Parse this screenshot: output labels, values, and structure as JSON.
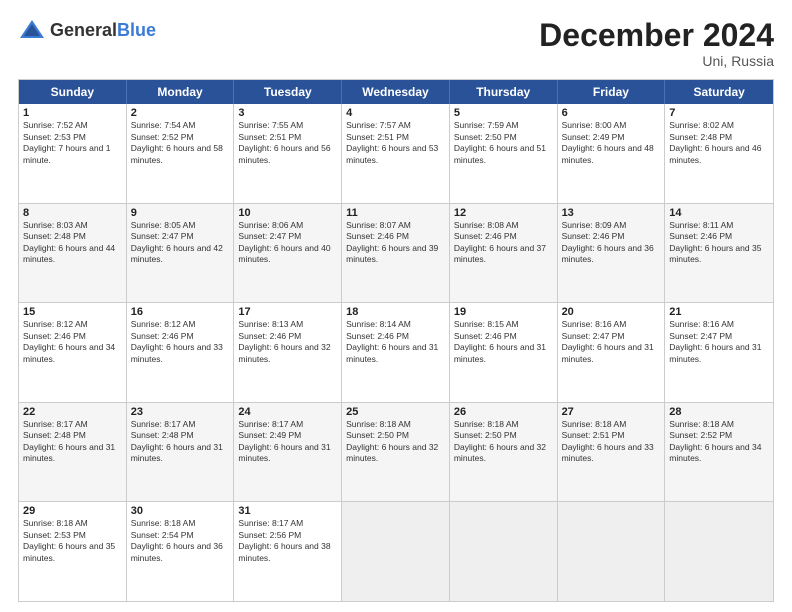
{
  "header": {
    "logo_general": "General",
    "logo_blue": "Blue",
    "title": "December 2024",
    "location": "Uni, Russia"
  },
  "days_of_week": [
    "Sunday",
    "Monday",
    "Tuesday",
    "Wednesday",
    "Thursday",
    "Friday",
    "Saturday"
  ],
  "weeks": [
    [
      {
        "day": "1",
        "sunrise": "Sunrise: 7:52 AM",
        "sunset": "Sunset: 2:53 PM",
        "daylight": "Daylight: 7 hours and 1 minute."
      },
      {
        "day": "2",
        "sunrise": "Sunrise: 7:54 AM",
        "sunset": "Sunset: 2:52 PM",
        "daylight": "Daylight: 6 hours and 58 minutes."
      },
      {
        "day": "3",
        "sunrise": "Sunrise: 7:55 AM",
        "sunset": "Sunset: 2:51 PM",
        "daylight": "Daylight: 6 hours and 56 minutes."
      },
      {
        "day": "4",
        "sunrise": "Sunrise: 7:57 AM",
        "sunset": "Sunset: 2:51 PM",
        "daylight": "Daylight: 6 hours and 53 minutes."
      },
      {
        "day": "5",
        "sunrise": "Sunrise: 7:59 AM",
        "sunset": "Sunset: 2:50 PM",
        "daylight": "Daylight: 6 hours and 51 minutes."
      },
      {
        "day": "6",
        "sunrise": "Sunrise: 8:00 AM",
        "sunset": "Sunset: 2:49 PM",
        "daylight": "Daylight: 6 hours and 48 minutes."
      },
      {
        "day": "7",
        "sunrise": "Sunrise: 8:02 AM",
        "sunset": "Sunset: 2:48 PM",
        "daylight": "Daylight: 6 hours and 46 minutes."
      }
    ],
    [
      {
        "day": "8",
        "sunrise": "Sunrise: 8:03 AM",
        "sunset": "Sunset: 2:48 PM",
        "daylight": "Daylight: 6 hours and 44 minutes."
      },
      {
        "day": "9",
        "sunrise": "Sunrise: 8:05 AM",
        "sunset": "Sunset: 2:47 PM",
        "daylight": "Daylight: 6 hours and 42 minutes."
      },
      {
        "day": "10",
        "sunrise": "Sunrise: 8:06 AM",
        "sunset": "Sunset: 2:47 PM",
        "daylight": "Daylight: 6 hours and 40 minutes."
      },
      {
        "day": "11",
        "sunrise": "Sunrise: 8:07 AM",
        "sunset": "Sunset: 2:46 PM",
        "daylight": "Daylight: 6 hours and 39 minutes."
      },
      {
        "day": "12",
        "sunrise": "Sunrise: 8:08 AM",
        "sunset": "Sunset: 2:46 PM",
        "daylight": "Daylight: 6 hours and 37 minutes."
      },
      {
        "day": "13",
        "sunrise": "Sunrise: 8:09 AM",
        "sunset": "Sunset: 2:46 PM",
        "daylight": "Daylight: 6 hours and 36 minutes."
      },
      {
        "day": "14",
        "sunrise": "Sunrise: 8:11 AM",
        "sunset": "Sunset: 2:46 PM",
        "daylight": "Daylight: 6 hours and 35 minutes."
      }
    ],
    [
      {
        "day": "15",
        "sunrise": "Sunrise: 8:12 AM",
        "sunset": "Sunset: 2:46 PM",
        "daylight": "Daylight: 6 hours and 34 minutes."
      },
      {
        "day": "16",
        "sunrise": "Sunrise: 8:12 AM",
        "sunset": "Sunset: 2:46 PM",
        "daylight": "Daylight: 6 hours and 33 minutes."
      },
      {
        "day": "17",
        "sunrise": "Sunrise: 8:13 AM",
        "sunset": "Sunset: 2:46 PM",
        "daylight": "Daylight: 6 hours and 32 minutes."
      },
      {
        "day": "18",
        "sunrise": "Sunrise: 8:14 AM",
        "sunset": "Sunset: 2:46 PM",
        "daylight": "Daylight: 6 hours and 31 minutes."
      },
      {
        "day": "19",
        "sunrise": "Sunrise: 8:15 AM",
        "sunset": "Sunset: 2:46 PM",
        "daylight": "Daylight: 6 hours and 31 minutes."
      },
      {
        "day": "20",
        "sunrise": "Sunrise: 8:16 AM",
        "sunset": "Sunset: 2:47 PM",
        "daylight": "Daylight: 6 hours and 31 minutes."
      },
      {
        "day": "21",
        "sunrise": "Sunrise: 8:16 AM",
        "sunset": "Sunset: 2:47 PM",
        "daylight": "Daylight: 6 hours and 31 minutes."
      }
    ],
    [
      {
        "day": "22",
        "sunrise": "Sunrise: 8:17 AM",
        "sunset": "Sunset: 2:48 PM",
        "daylight": "Daylight: 6 hours and 31 minutes."
      },
      {
        "day": "23",
        "sunrise": "Sunrise: 8:17 AM",
        "sunset": "Sunset: 2:48 PM",
        "daylight": "Daylight: 6 hours and 31 minutes."
      },
      {
        "day": "24",
        "sunrise": "Sunrise: 8:17 AM",
        "sunset": "Sunset: 2:49 PM",
        "daylight": "Daylight: 6 hours and 31 minutes."
      },
      {
        "day": "25",
        "sunrise": "Sunrise: 8:18 AM",
        "sunset": "Sunset: 2:50 PM",
        "daylight": "Daylight: 6 hours and 32 minutes."
      },
      {
        "day": "26",
        "sunrise": "Sunrise: 8:18 AM",
        "sunset": "Sunset: 2:50 PM",
        "daylight": "Daylight: 6 hours and 32 minutes."
      },
      {
        "day": "27",
        "sunrise": "Sunrise: 8:18 AM",
        "sunset": "Sunset: 2:51 PM",
        "daylight": "Daylight: 6 hours and 33 minutes."
      },
      {
        "day": "28",
        "sunrise": "Sunrise: 8:18 AM",
        "sunset": "Sunset: 2:52 PM",
        "daylight": "Daylight: 6 hours and 34 minutes."
      }
    ],
    [
      {
        "day": "29",
        "sunrise": "Sunrise: 8:18 AM",
        "sunset": "Sunset: 2:53 PM",
        "daylight": "Daylight: 6 hours and 35 minutes."
      },
      {
        "day": "30",
        "sunrise": "Sunrise: 8:18 AM",
        "sunset": "Sunset: 2:54 PM",
        "daylight": "Daylight: 6 hours and 36 minutes."
      },
      {
        "day": "31",
        "sunrise": "Sunrise: 8:17 AM",
        "sunset": "Sunset: 2:56 PM",
        "daylight": "Daylight: 6 hours and 38 minutes."
      },
      null,
      null,
      null,
      null
    ]
  ]
}
